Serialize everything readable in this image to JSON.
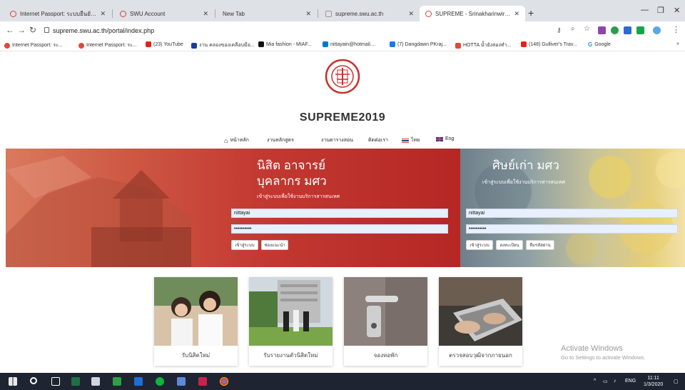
{
  "browser": {
    "tabs": [
      {
        "title": "Internet Passport: ระบบยืนยันตัวตน",
        "active": false
      },
      {
        "title": "SWU Account",
        "active": false
      },
      {
        "title": "New Tab",
        "active": false
      },
      {
        "title": "supreme.swu.ac.th",
        "active": false
      },
      {
        "title": "SUPREME - Srinakharinwirot Univ",
        "active": true
      }
    ],
    "new_tab_label": "+",
    "url": "supreme.swu.ac.th/portal/index.php",
    "bookmarks": [
      {
        "label": "Internet Passport: ระ...",
        "color": "#e04a3a"
      },
      {
        "label": "Internet Passport: ระ...",
        "color": "#e04a3a"
      },
      {
        "label": "(23) YouTube",
        "color": "#e62117"
      },
      {
        "label": "งาน คลองของเคลือบมือ...",
        "color": "#1a3aa5"
      },
      {
        "label": "Mia fashion - MIAF...",
        "color": "#111111"
      },
      {
        "label": "nittayain@hotmail....",
        "color": "#0078d4"
      },
      {
        "label": "(7) Dangdawn PKraj...",
        "color": "#1877f2"
      },
      {
        "label": "HOTTA น้ำยังสองทำ...",
        "color": "#e04a3a"
      },
      {
        "label": "(148) Gulliver's Trav...",
        "color": "#e62117"
      },
      {
        "label": "Google",
        "color": "#4285f4"
      }
    ],
    "more_bookmarks": "»"
  },
  "page": {
    "site_title": "SUPREME2019",
    "menu": [
      {
        "label": "หน้าหลัก",
        "icon": "home-icon"
      },
      {
        "label": "งานหลักสูตร"
      },
      {
        "label": "งานตารางสอน"
      },
      {
        "label": "ติดต่อเรา"
      },
      {
        "label": "ไทย",
        "icon": "thai-flag-icon"
      },
      {
        "label": "Eng",
        "icon": "uk-flag-icon"
      }
    ],
    "login_main": {
      "heading1": "นิสิต อาจารย์",
      "heading2": "บุคลากร มศว",
      "subtitle": "เข้าสู่ระบบเพื่อใช้งานบริการสารสนเทศ",
      "username": "nittayai",
      "password": "••••••••••",
      "buttons": [
        "เข้าสู่ระบบ",
        "ช่องแนะนำ"
      ]
    },
    "login_alumni": {
      "heading": "ศิษย์เก่า มศว",
      "subtitle": "เข้าสู่ระบบเพื่อใช้งานบริการสารสนเทศ",
      "username": "nittayai",
      "password": "••••••••••",
      "buttons": [
        "เข้าสู่ระบบ",
        "ลงทะเบียน",
        "ลืมรหัสผ่าน"
      ]
    },
    "cards": [
      {
        "label": "รับนิสิตใหม่"
      },
      {
        "label": "รับรายงานตัวนิสิตใหม่"
      },
      {
        "label": "จองหอพัก"
      },
      {
        "label": "ตรวจสอบวุฒิจากภายนอก"
      }
    ],
    "watermark": {
      "line1": "Activate Windows",
      "line2": "Go to Settings to activate Windows."
    }
  },
  "taskbar": {
    "lang": "ENG",
    "time": "11:11",
    "date": "1/3/2020"
  }
}
